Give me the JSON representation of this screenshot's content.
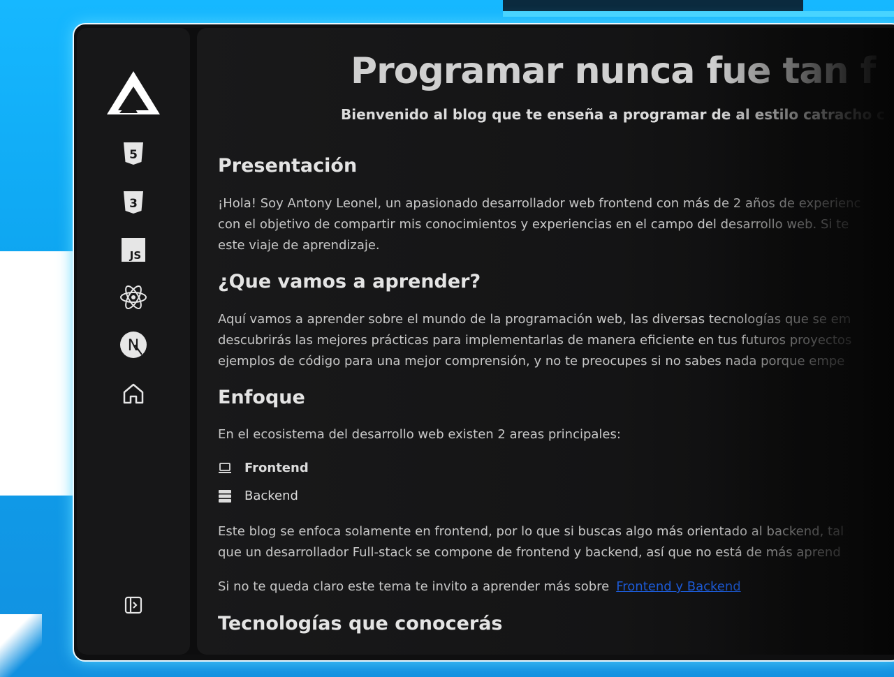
{
  "sidebar": {
    "logo": "logo-triangle-icon",
    "items": [
      {
        "icon": "html5-icon",
        "label": "5"
      },
      {
        "icon": "css3-icon",
        "label": "3"
      },
      {
        "icon": "javascript-icon",
        "label": "JS"
      },
      {
        "icon": "react-icon"
      },
      {
        "icon": "nextjs-icon",
        "label": "N"
      },
      {
        "icon": "home-icon"
      }
    ],
    "toggle": "sidebar-toggle-icon"
  },
  "header": {
    "title": "Programar nunca fue tan f",
    "subtitle": "Bienvenido al blog que te enseña a programar de al estilo catracho c"
  },
  "sections": {
    "presentacion": {
      "heading": "Presentación",
      "lines": [
        "¡Hola! Soy Antony Leonel, un apasionado desarrollador web frontend con más de 2 años de experienc",
        "con el objetivo de compartir mis conocimientos y experiencias en el campo del desarrollo web. Si te",
        "este viaje de aprendizaje."
      ]
    },
    "aprender": {
      "heading": "¿Que vamos a aprender?",
      "lines": [
        "Aquí vamos a aprender sobre el mundo de la programación web, las diversas tecnologías que se em",
        "descubrirás las mejores prácticas para implementarlas de manera eficiente en tus futuros proyectos",
        "ejemplos de código para una mejor comprensión, y no te preocupes si no sabes nada porque empe"
      ]
    },
    "enfoque": {
      "heading": "Enfoque",
      "intro": "En el ecosistema del desarrollo web existen 2 areas principales:",
      "list": [
        {
          "icon": "laptop-icon",
          "label": "Frontend"
        },
        {
          "icon": "server-icon",
          "label": "Backend"
        }
      ],
      "lines": [
        "Este blog se enfoca solamente en frontend, por lo que si buscas algo más orientado al backend, tal",
        "que un desarrollador Full-stack se compone de frontend y backend, así que no está de más aprend"
      ],
      "more_text": "Si no te queda claro este tema te invito a aprender más sobre",
      "more_link": "Frontend y Backend"
    },
    "tecnologias": {
      "heading": "Tecnologías que conocerás"
    }
  },
  "colors": {
    "accent_blue": "#16b8ff",
    "link": "#1c5ad6",
    "panel": "#171718"
  }
}
